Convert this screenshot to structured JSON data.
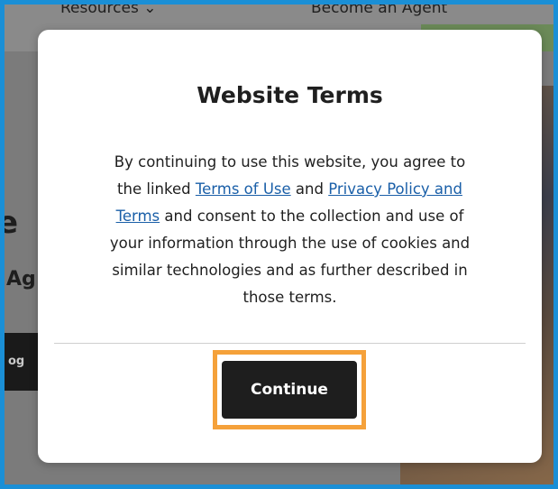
{
  "background": {
    "nav": {
      "resources_label": "Resources",
      "resources_chevron": "chevron-down-icon",
      "become_agent_label": "Become an Agent"
    },
    "heading_fragment": "e",
    "subheading_fragment": "Ag",
    "button_fragment": "og"
  },
  "modal": {
    "title": "Website Terms",
    "body": {
      "text_1": "By continuing to use this website, you agree to the linked ",
      "link_terms": "Terms of Use",
      "text_2": " and ",
      "link_privacy": "Privacy Policy and Terms",
      "text_3": " and consent to the collection and use of your information through the use of cookies and similar technologies and as further described in those terms."
    },
    "continue_label": "Continue"
  },
  "colors": {
    "frame_border": "#1a8fd6",
    "highlight": "#f5a13a",
    "link": "#1a5fa8",
    "button_bg": "#1e1e1e"
  }
}
